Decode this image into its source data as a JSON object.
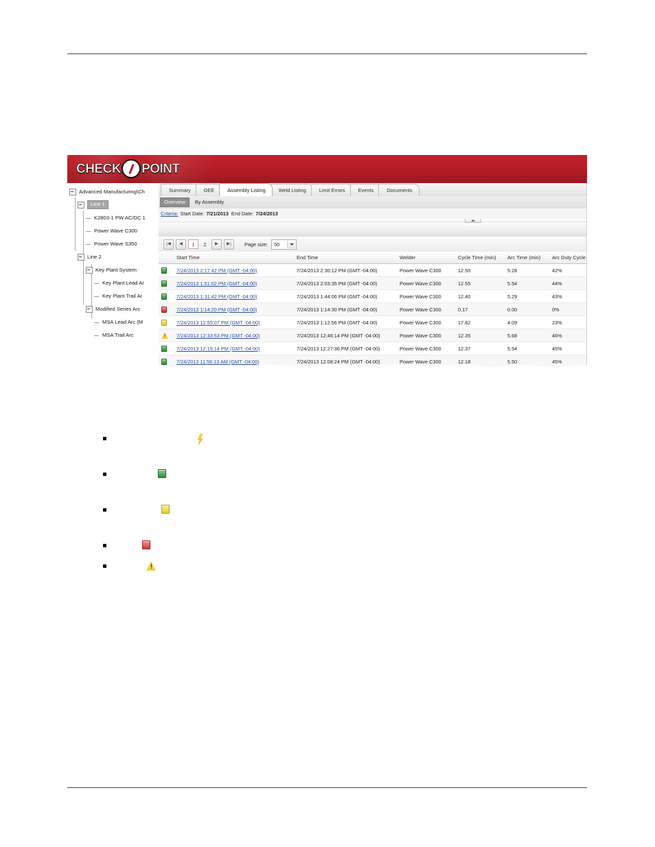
{
  "page": {
    "header_rule": true,
    "footer_rule": true
  },
  "app": {
    "logo": {
      "text_left": "CHECK",
      "text_right": "POINT",
      "slash_icon": "slash-circle-icon",
      "banner_color": "#b51e27"
    }
  },
  "tree": {
    "items": [
      {
        "label": "Advanced Manufacturing\\Ch",
        "level": 1,
        "expander": "minus",
        "selected": false
      },
      {
        "label": "Line 1",
        "level": 2,
        "expander": "minus",
        "selected": true
      },
      {
        "label": "K2803-1 PW AC/DC 1",
        "level": 3,
        "expander": "none",
        "selected": false
      },
      {
        "label": "Power Wave C300",
        "level": 3,
        "expander": "none",
        "selected": false
      },
      {
        "label": "Power Wave S350",
        "level": 3,
        "expander": "none",
        "selected": false
      },
      {
        "label": "Line 2",
        "level": 2,
        "expander": "minus",
        "selected": false
      },
      {
        "label": "Key Plant System",
        "level": 3,
        "expander": "minus",
        "selected": false
      },
      {
        "label": "Key Plant Lead Ar",
        "level": 4,
        "expander": "none",
        "selected": false
      },
      {
        "label": "Key Plant Trail Ar",
        "level": 4,
        "expander": "none",
        "selected": false
      },
      {
        "label": "Modified Series Arc",
        "level": 3,
        "expander": "minus",
        "selected": false
      },
      {
        "label": "MSA Lead Arc (M",
        "level": 4,
        "expander": "none",
        "selected": false
      },
      {
        "label": "MSA Trail Arc",
        "level": 4,
        "expander": "none",
        "selected": false
      }
    ]
  },
  "tabs": {
    "items": [
      {
        "label": "Summary",
        "active": false
      },
      {
        "label": "OEE",
        "active": false
      },
      {
        "label": "Assembly Listing",
        "active": true
      },
      {
        "label": "Weld Listing",
        "active": false
      },
      {
        "label": "Limit Errors",
        "active": false
      },
      {
        "label": "Events",
        "active": false
      },
      {
        "label": "Documents",
        "active": false
      }
    ]
  },
  "subtabs": {
    "items": [
      {
        "label": "Overview",
        "active": true
      },
      {
        "label": "By Assembly",
        "active": false
      }
    ]
  },
  "criteria": {
    "link_label": "Criteria:",
    "start_label": "Start Date:",
    "start_value": "7/21/2013",
    "end_label": "End Date:",
    "end_value": "7/24/2013"
  },
  "pager": {
    "first_label": "|◀",
    "prev_label": "◀",
    "pages": [
      "1",
      "2"
    ],
    "current_page": "1",
    "next_label": "▶",
    "last_label": "▶|",
    "page_size_label": "Page size:",
    "page_size_value": "50"
  },
  "grid": {
    "columns": [
      "Start Time",
      "End Time",
      "Welder",
      "Cycle Time (min)",
      "Arc Time (min)",
      "Arc Duty Cycle"
    ],
    "rows": [
      {
        "status": "green",
        "start_time": "7/24/2013 2:17:42 PM (GMT -04:00)",
        "end_time": "7/24/2013 2:30:12 PM (GMT -04:00)",
        "welder": "Power Wave C300",
        "cycle_time": "12.50",
        "arc_time": "5.28",
        "arc_duty_cycle": "42%"
      },
      {
        "status": "green",
        "start_time": "7/24/2013 1:51:02 PM (GMT -04:00)",
        "end_time": "7/24/2013 2:03:35 PM (GMT -04:00)",
        "welder": "Power Wave C300",
        "cycle_time": "12.55",
        "arc_time": "5.54",
        "arc_duty_cycle": "44%"
      },
      {
        "status": "green",
        "start_time": "7/24/2013 1:31:42 PM (GMT -04:00)",
        "end_time": "7/24/2013 1:44:06 PM (GMT -04:00)",
        "welder": "Power Wave C300",
        "cycle_time": "12.40",
        "arc_time": "5.29",
        "arc_duty_cycle": "43%"
      },
      {
        "status": "red",
        "start_time": "7/24/2013 1:14:20 PM (GMT -04:00)",
        "end_time": "7/24/2013 1:14:30 PM (GMT -04:00)",
        "welder": "Power Wave C300",
        "cycle_time": "0.17",
        "arc_time": "0.00",
        "arc_duty_cycle": "0%"
      },
      {
        "status": "yellow",
        "start_time": "7/24/2013 12:55:07 PM (GMT -04:00)",
        "end_time": "7/24/2013 1:12:56 PM (GMT -04:00)",
        "welder": "Power Wave C300",
        "cycle_time": "17.82",
        "arc_time": "4.09",
        "arc_duty_cycle": "23%"
      },
      {
        "status": "warn",
        "start_time": "7/24/2013 12:33:53 PM (GMT -04:00)",
        "end_time": "7/24/2013 12:46:14 PM (GMT -04:00)",
        "welder": "Power Wave C300",
        "cycle_time": "12.35",
        "arc_time": "5.68",
        "arc_duty_cycle": "46%"
      },
      {
        "status": "green",
        "start_time": "7/24/2013 12:15:14 PM (GMT -04:00)",
        "end_time": "7/24/2013 12:27:36 PM (GMT -04:00)",
        "welder": "Power Wave C300",
        "cycle_time": "12.37",
        "arc_time": "5.54",
        "arc_duty_cycle": "45%"
      },
      {
        "status": "green",
        "start_time": "7/24/2013 11:56:13 AM (GMT -04:00)",
        "end_time": "7/24/2013 12:08:24 PM (GMT -04:00)",
        "welder": "Power Wave C300",
        "cycle_time": "12.18",
        "arc_time": "5.50",
        "arc_duty_cycle": "45%"
      }
    ]
  },
  "legend": {
    "items": [
      {
        "icon": "lightning-bolt-icon",
        "text": ""
      },
      {
        "icon": "green-square-icon",
        "text": ""
      },
      {
        "icon": "yellow-square-icon",
        "text": ""
      },
      {
        "icon": "red-square-icon",
        "text": ""
      },
      {
        "icon": "warning-triangle-icon",
        "text": ""
      }
    ]
  }
}
